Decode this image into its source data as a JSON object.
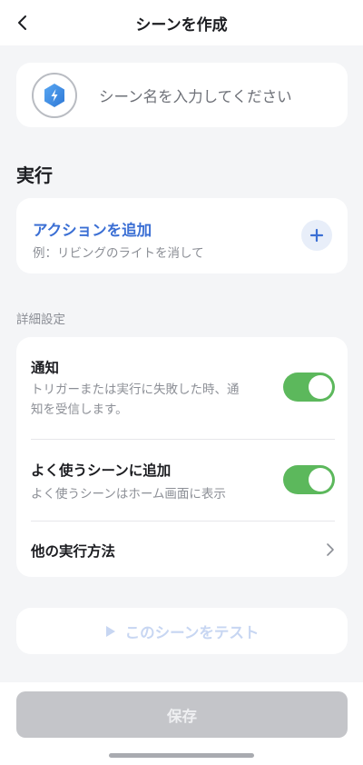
{
  "header": {
    "title": "シーンを作成",
    "back_icon": "chevron-left-icon"
  },
  "scene_name": {
    "placeholder": "シーン名を入力してください",
    "icon": "lightning-hexagon-icon",
    "accent": "#3b8fe8"
  },
  "execution": {
    "title": "実行",
    "action_title": "アクションを追加",
    "action_example": "例：リビングのライトを消して",
    "add_icon": "plus-icon"
  },
  "details": {
    "title": "詳細設定",
    "notify": {
      "title": "通知",
      "desc_line1": "トリガーまたは実行に失敗した時、通",
      "desc_line2": "知を受信します。",
      "enabled": true
    },
    "favorite": {
      "title": "よく使うシーンに追加",
      "desc": "よく使うシーンはホーム画面に表示",
      "enabled": true
    },
    "other": {
      "title": "他の実行方法",
      "icon": "chevron-right-icon"
    }
  },
  "test": {
    "label": "このシーンをテスト",
    "icon": "play-icon"
  },
  "save": {
    "label": "保存"
  },
  "colors": {
    "toggle_on": "#5cb85c",
    "link": "#3b6fd4"
  }
}
